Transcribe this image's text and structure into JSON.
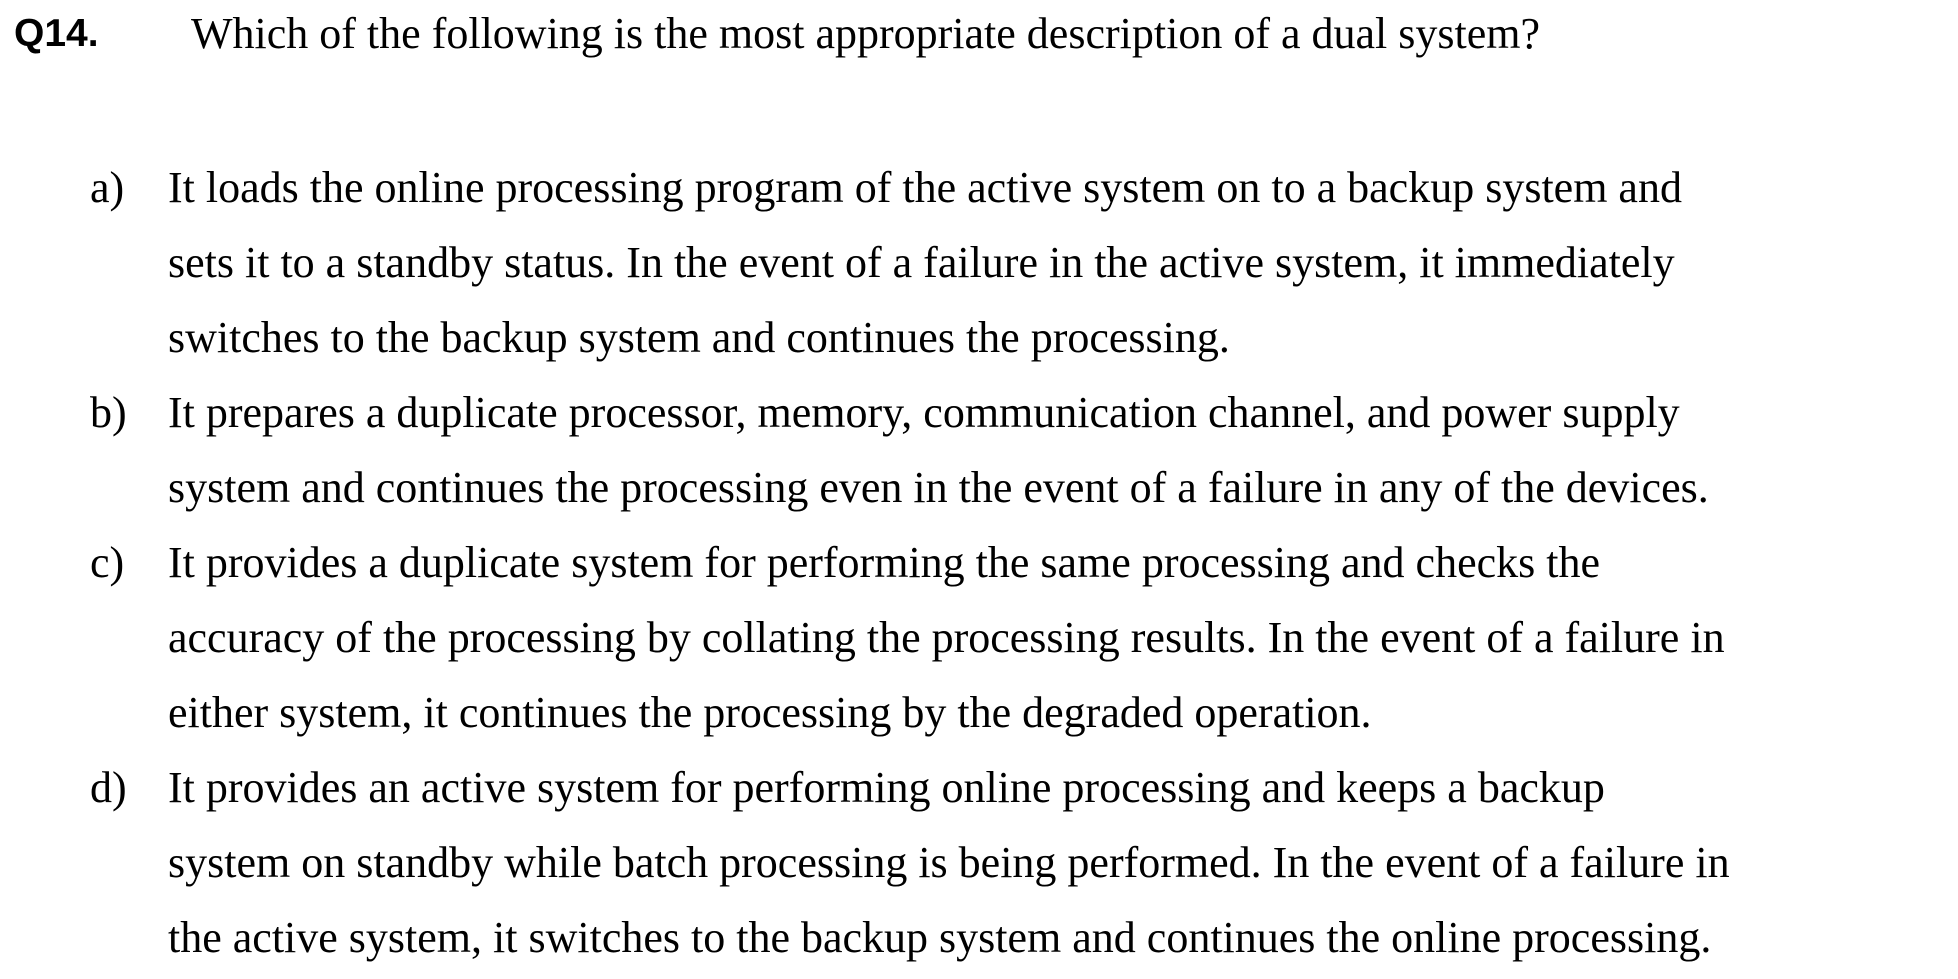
{
  "question": {
    "number": "Q14.",
    "text": "Which of the following is the most appropriate description of a dual system?"
  },
  "options": [
    {
      "letter": "a)",
      "lines": [
        "It loads the online processing program of the active system on to a backup system and",
        "sets it to a standby status. In the event of a failure in the active system, it immediately",
        "switches to the backup system and continues the processing."
      ]
    },
    {
      "letter": "b)",
      "lines": [
        "It prepares a duplicate processor, memory, communication channel, and power supply",
        "system and continues the processing even in the event of a failure in any of the devices."
      ]
    },
    {
      "letter": "c)",
      "lines": [
        "It provides a duplicate system for performing the same processing and checks the",
        "accuracy of the processing by collating the processing results. In the event of a failure in",
        "either system, it continues the processing by the degraded operation."
      ]
    },
    {
      "letter": "d)",
      "lines": [
        "It provides an active system for performing online processing and keeps a backup",
        "system on standby while batch processing is being performed. In the event of a failure in",
        "the active system, it switches to the backup system and continues the online processing."
      ]
    }
  ]
}
